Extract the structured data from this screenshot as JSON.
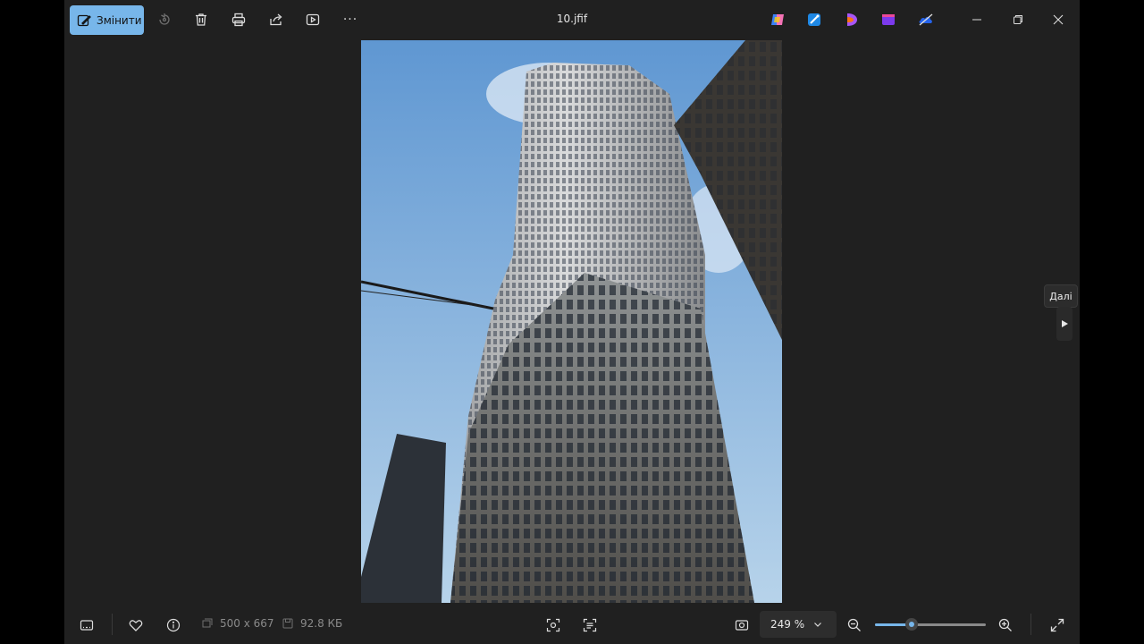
{
  "toolbar": {
    "edit_label": "Змінити",
    "icons": [
      "rotate-icon",
      "delete-icon",
      "print-icon",
      "share-icon",
      "slideshow-icon",
      "more-icon"
    ],
    "more_label": "···"
  },
  "window": {
    "title": "10.jfif",
    "app_icons": [
      "copilot-icon",
      "designer-icon",
      "clipchamp-icon",
      "video-editor-icon",
      "onedrive-icon"
    ],
    "controls": [
      "minimize-icon",
      "maximize-icon",
      "close-icon"
    ]
  },
  "navigation": {
    "next_tooltip": "Далі"
  },
  "status": {
    "dimensions": "500 x 667",
    "file_size": "92.8 КБ"
  },
  "zoom": {
    "level": "249 %",
    "slider_fraction": 0.33
  },
  "colors": {
    "accent": "#77b6ea",
    "background": "#202020"
  }
}
